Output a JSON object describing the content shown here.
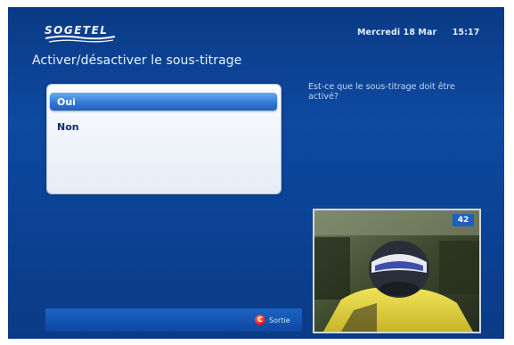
{
  "header": {
    "brand": "SOGETEL",
    "date": "Mercredi 18 Mar",
    "time": "15:17"
  },
  "page": {
    "title": "Activer/désactiver le sous-titrage",
    "help_text": "Est-ce que le sous-titrage doit être activé?"
  },
  "menu": {
    "options": [
      {
        "label": "Oui",
        "selected": true
      },
      {
        "label": "Non",
        "selected": false
      }
    ]
  },
  "preview": {
    "channel_number": "42"
  },
  "footer": {
    "exit_key": "C",
    "exit_label": "Sortie"
  },
  "colors": {
    "background": "#0e4aa0",
    "selection": "#2f77d6",
    "exit_button": "#d8231a"
  }
}
